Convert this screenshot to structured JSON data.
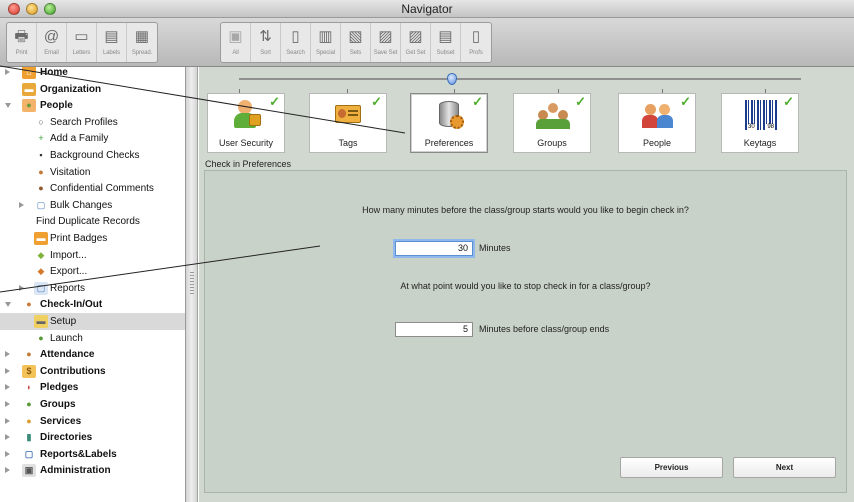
{
  "window": {
    "title": "Navigator"
  },
  "toolbar": {
    "group1": [
      {
        "label": "Print",
        "icon": "printer-icon",
        "dim": false
      },
      {
        "label": "Email",
        "icon": "email-icon",
        "dim": false
      },
      {
        "label": "Letters",
        "icon": "letters-icon",
        "dim": false
      },
      {
        "label": "Labels",
        "icon": "labels-icon",
        "dim": false
      },
      {
        "label": "Spread.",
        "icon": "spreadsheet-icon",
        "dim": false
      }
    ],
    "group2": [
      {
        "label": "All",
        "icon": "all-icon",
        "dim": true
      },
      {
        "label": "Sort",
        "icon": "sort-icon",
        "dim": false
      },
      {
        "label": "Search",
        "icon": "search-icon",
        "dim": false
      },
      {
        "label": "Special",
        "icon": "special-icon",
        "dim": false
      },
      {
        "label": "Sets",
        "icon": "sets-icon",
        "dim": false
      },
      {
        "label": "Save Set",
        "icon": "save-set-icon",
        "dim": false
      },
      {
        "label": "Get Set",
        "icon": "get-set-icon",
        "dim": false
      },
      {
        "label": "Subset",
        "icon": "subset-icon",
        "dim": false
      },
      {
        "label": "Profs",
        "icon": "profs-icon",
        "dim": false
      }
    ]
  },
  "sidebar": {
    "items": [
      {
        "label": "Home",
        "bold": true,
        "level": 0,
        "expander": "right",
        "icon": "home-icon"
      },
      {
        "label": "Organization",
        "bold": true,
        "level": 0,
        "expander": "",
        "icon": "organization-icon"
      },
      {
        "label": "People",
        "bold": true,
        "level": 0,
        "expander": "down",
        "icon": "people-icon"
      },
      {
        "label": "Search Profiles",
        "bold": false,
        "level": 1,
        "expander": "",
        "icon": "magnifier-icon"
      },
      {
        "label": "Add a Family",
        "bold": false,
        "level": 1,
        "expander": "",
        "icon": "add-family-icon"
      },
      {
        "label": "Background Checks",
        "bold": false,
        "level": 1,
        "expander": "",
        "icon": "background-check-icon"
      },
      {
        "label": "Visitation",
        "bold": false,
        "level": 1,
        "expander": "",
        "icon": "visitation-icon"
      },
      {
        "label": "Confidential Comments",
        "bold": false,
        "level": 1,
        "expander": "",
        "icon": "confidential-icon"
      },
      {
        "label": "Bulk Changes",
        "bold": false,
        "level": 1,
        "expander": "right",
        "icon": "bulk-changes-icon"
      },
      {
        "label": "Find Duplicate Records",
        "bold": false,
        "level": 1,
        "expander": "",
        "icon": ""
      },
      {
        "label": "Print Badges",
        "bold": false,
        "level": 1,
        "expander": "",
        "icon": "badge-icon"
      },
      {
        "label": "Import...",
        "bold": false,
        "level": 1,
        "expander": "",
        "icon": "import-icon"
      },
      {
        "label": "Export...",
        "bold": false,
        "level": 1,
        "expander": "",
        "icon": "export-icon"
      },
      {
        "label": "Reports",
        "bold": false,
        "level": 1,
        "expander": "right",
        "icon": "reports-icon"
      },
      {
        "label": "Check-In/Out",
        "bold": true,
        "level": 0,
        "expander": "down",
        "icon": "check-in-icon"
      },
      {
        "label": "Setup",
        "bold": false,
        "level": 1,
        "expander": "",
        "icon": "setup-icon",
        "selected": true
      },
      {
        "label": "Launch",
        "bold": false,
        "level": 1,
        "expander": "",
        "icon": "launch-icon"
      },
      {
        "label": "Attendance",
        "bold": true,
        "level": 0,
        "expander": "right",
        "icon": "attendance-icon"
      },
      {
        "label": "Contributions",
        "bold": true,
        "level": 0,
        "expander": "right",
        "icon": "contributions-icon"
      },
      {
        "label": "Pledges",
        "bold": true,
        "level": 0,
        "expander": "right",
        "icon": "pledges-icon"
      },
      {
        "label": "Groups",
        "bold": true,
        "level": 0,
        "expander": "right",
        "icon": "groups-icon"
      },
      {
        "label": "Services",
        "bold": true,
        "level": 0,
        "expander": "right",
        "icon": "services-icon"
      },
      {
        "label": "Directories",
        "bold": true,
        "level": 0,
        "expander": "right",
        "icon": "directories-icon"
      },
      {
        "label": "Reports&Labels",
        "bold": true,
        "level": 0,
        "expander": "right",
        "icon": "reports-labels-icon"
      },
      {
        "label": "Administration",
        "bold": true,
        "level": 0,
        "expander": "right",
        "icon": "administration-icon"
      }
    ]
  },
  "wizard": {
    "steps": [
      {
        "label": "User Security",
        "icon": "user-security-icon",
        "checked": true
      },
      {
        "label": "Tags",
        "icon": "tags-icon",
        "checked": true
      },
      {
        "label": "Preferences",
        "icon": "preferences-icon",
        "checked": true,
        "active": true
      },
      {
        "label": "Groups",
        "icon": "groups-icon",
        "checked": true
      },
      {
        "label": "People",
        "icon": "people-icon",
        "checked": true
      },
      {
        "label": "Keytags",
        "icon": "keytags-icon",
        "checked": true
      }
    ],
    "section_title": "Check in Preferences",
    "question1": "How many minutes before the class/group starts would you like to begin check in?",
    "field1_value": "30",
    "field1_unit": "Minutes",
    "question2": "At what point would you like to stop check in for a class/group?",
    "field2_value": "5",
    "field2_unit": "Minutes before class/group ends",
    "previous_label": "Previous",
    "next_label": "Next"
  }
}
